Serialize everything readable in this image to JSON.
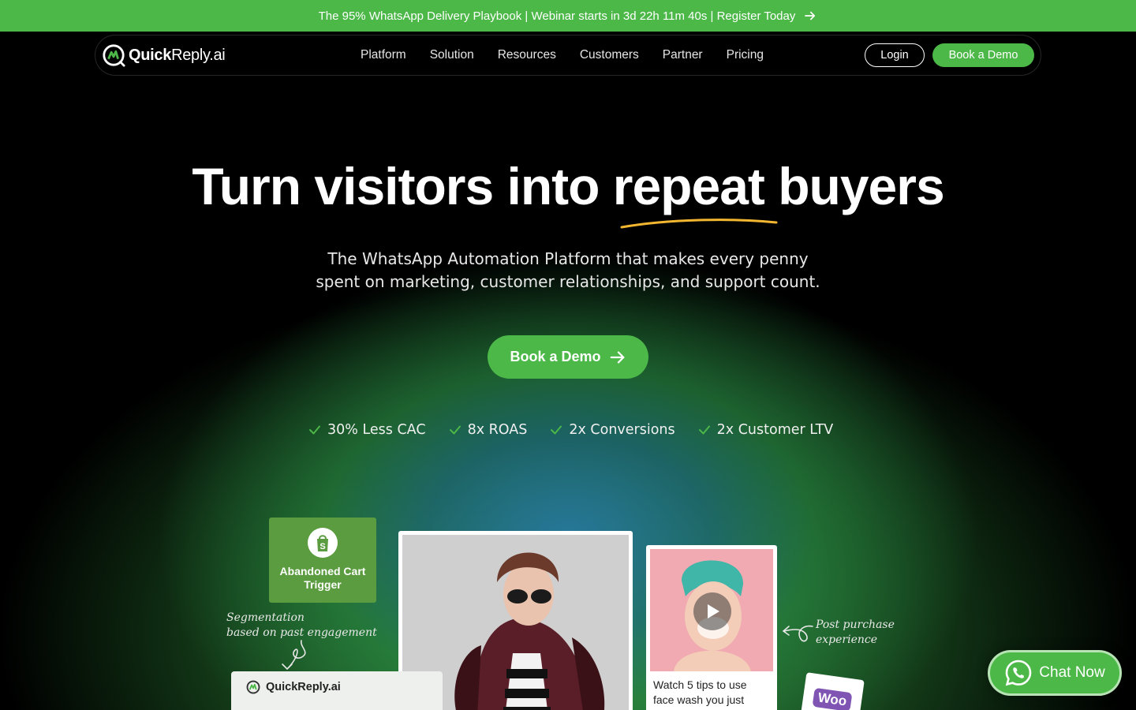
{
  "announcement": {
    "text": "The 95% WhatsApp Delivery Playbook | Webinar starts in 3d 22h 11m 40s | Register Today",
    "icon": "arrow-right-icon"
  },
  "nav": {
    "logo_bold": "Quick",
    "logo_light": "Reply.ai",
    "links": [
      "Platform",
      "Solution",
      "Resources",
      "Customers",
      "Partner",
      "Pricing"
    ],
    "login_label": "Login",
    "demo_label": "Book a Demo"
  },
  "hero": {
    "headline": "Turn visitors into repeat buyers",
    "subtitle_line1": "The WhatsApp Automation Platform that makes every penny",
    "subtitle_line2": "spent on marketing, customer relationships, and support count.",
    "cta_label": "Book a Demo",
    "features": [
      "30% Less CAC",
      "8x ROAS",
      "2x Conversions",
      "2x Customer LTV"
    ]
  },
  "showcase": {
    "trigger_label_line1": "Abandoned Cart",
    "trigger_label_line2": "Trigger",
    "note_left_line1": "Segmentation",
    "note_left_line2": "based on past engagement",
    "note_right_line1": "Post purchase",
    "note_right_line2": "experience",
    "video_caption_line1": "Watch 5 tips to use",
    "video_caption_line2": "face wash you just",
    "woo_label": "Woo",
    "qr_card_label": "QuickReply.ai"
  },
  "chat": {
    "label": "Chat Now"
  },
  "colors": {
    "brand_green": "#4CB848",
    "background": "#000000",
    "underline_accent": "#F2B630"
  }
}
